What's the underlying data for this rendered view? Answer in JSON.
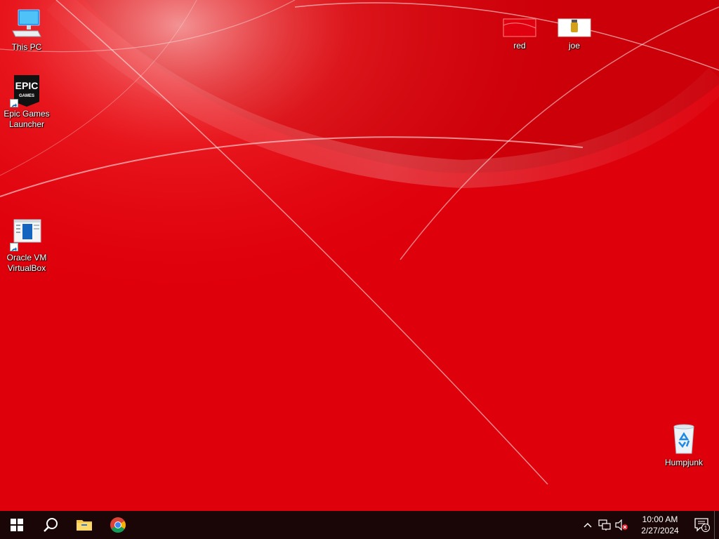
{
  "desktop": {
    "icons": {
      "this_pc": {
        "label": "This PC"
      },
      "epic": {
        "label": "Epic Games Launcher",
        "logo_top": "EPIC",
        "logo_bottom": "GAMES"
      },
      "virtualbox": {
        "label": "Oracle VM VirtualBox"
      },
      "red": {
        "label": "red"
      },
      "joe": {
        "label": "joe"
      },
      "recycle": {
        "label": "Humpjunk"
      }
    }
  },
  "taskbar": {
    "start_icon": "windows-logo-icon",
    "search_icon": "search-icon",
    "pinned": [
      {
        "name": "file-explorer",
        "icon": "folder-icon"
      },
      {
        "name": "chrome",
        "icon": "chrome-icon"
      }
    ],
    "tray": {
      "icons": [
        "chevron-up-icon",
        "network-icon",
        "volume-muted-icon"
      ],
      "time": "10:00 AM",
      "date": "2/27/2024",
      "notification_count": "1"
    }
  },
  "colors": {
    "wallpaper": "#e3000b",
    "taskbar": "#1a0606",
    "accent": "#0078d7"
  }
}
